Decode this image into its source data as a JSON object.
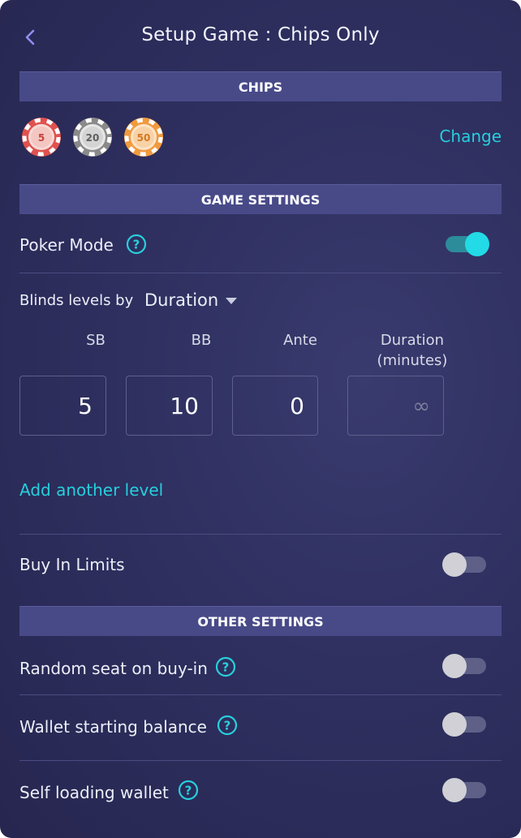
{
  "header": {
    "title": "Setup Game : Chips Only"
  },
  "chips_section": {
    "heading": "CHIPS",
    "chips": [
      {
        "value": "5",
        "color": "#e0524f"
      },
      {
        "value": "20",
        "color": "#8a8a8a"
      },
      {
        "value": "50",
        "color": "#f19a3e"
      }
    ],
    "change_label": "Change"
  },
  "game_settings": {
    "heading": "GAME SETTINGS",
    "poker_mode": {
      "label": "Poker Mode",
      "enabled": true
    },
    "blinds": {
      "label": "Blinds levels by",
      "mode": "Duration",
      "columns": {
        "sb": "SB",
        "bb": "BB",
        "ante": "Ante",
        "duration_line1": "Duration",
        "duration_line2": "(minutes)"
      },
      "level": {
        "sb": "5",
        "bb": "10",
        "ante": "0",
        "duration_placeholder": "∞"
      },
      "add_level": "Add another level"
    },
    "buy_in_limits": {
      "label": "Buy In Limits",
      "enabled": false
    }
  },
  "other_settings": {
    "heading": "OTHER SETTINGS",
    "random_seat": {
      "label": "Random seat on buy-in",
      "enabled": false
    },
    "wallet_balance": {
      "label": "Wallet starting balance",
      "enabled": false
    },
    "self_loading_wallet": {
      "label": "Self loading wallet",
      "enabled": false
    }
  },
  "colors": {
    "accent": "#27cfdc",
    "section_bar": "#484a88",
    "background": "#2f3060"
  },
  "icons": {
    "back": "chevron-left-icon",
    "help": "question-circle-icon",
    "caret": "caret-down-icon"
  }
}
